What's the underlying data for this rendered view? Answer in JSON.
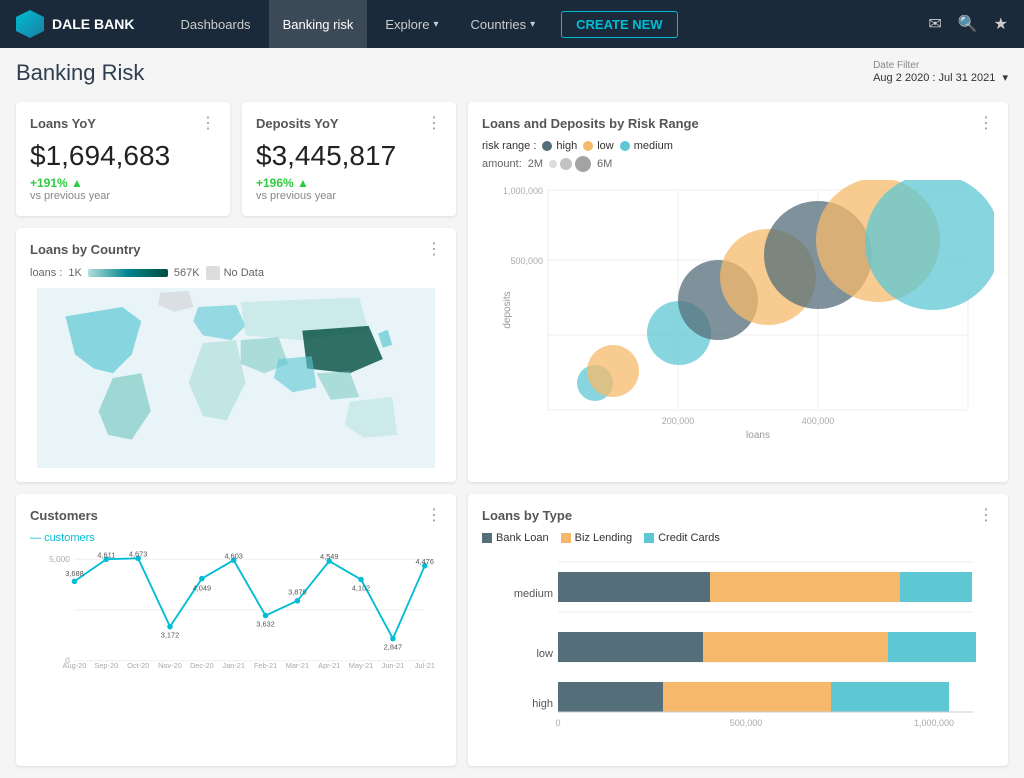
{
  "brand": {
    "name": "DALE BANK"
  },
  "nav": {
    "links": [
      {
        "id": "dashboards",
        "label": "Dashboards",
        "active": false,
        "hasChevron": false
      },
      {
        "id": "banking-risk",
        "label": "Banking risk",
        "active": true,
        "hasChevron": false
      },
      {
        "id": "explore",
        "label": "Explore",
        "active": false,
        "hasChevron": true
      },
      {
        "id": "countries",
        "label": "Countries",
        "active": false,
        "hasChevron": true
      }
    ],
    "create_label": "CREATE NEW"
  },
  "page": {
    "title": "Banking Risk",
    "date_filter_label": "Date Filter",
    "date_filter_value": "Aug 2 2020 : Jul 31 2021"
  },
  "kpi": {
    "loans": {
      "title": "Loans YoY",
      "value": "$1,694,683",
      "change": "+191%",
      "vs": "vs previous year"
    },
    "deposits": {
      "title": "Deposits YoY",
      "value": "$3,445,817",
      "change": "+196%",
      "vs": "vs previous year"
    }
  },
  "map": {
    "title": "Loans by Country",
    "legend_min": "1K",
    "legend_max": "567K",
    "legend_nodata": "No Data"
  },
  "customers": {
    "title": "Customers",
    "legend_label": "customers",
    "y_max": "5,000",
    "y_min": "0",
    "points": [
      {
        "label": "Aug-20",
        "value": 3688
      },
      {
        "label": "Sep-20",
        "value": 4611
      },
      {
        "label": "Oct-20",
        "value": 4673
      },
      {
        "label": "Nov-20",
        "value": 3172
      },
      {
        "label": "Dec-20",
        "value": 4049
      },
      {
        "label": "Jan-21",
        "value": 4603
      },
      {
        "label": "Feb-21",
        "value": 3632
      },
      {
        "label": "Mar-21",
        "value": 3879
      },
      {
        "label": "Apr-21",
        "value": 4549
      },
      {
        "label": "May-21",
        "value": 4102
      },
      {
        "label": "Jun-21",
        "value": 2847
      },
      {
        "label": "Jul-21",
        "value": 4476
      }
    ]
  },
  "scatter": {
    "title": "Loans and Deposits by Risk Range",
    "risk_label": "risk range :",
    "amount_label": "amount:",
    "amount_min": "2M",
    "amount_max": "6M",
    "legend": [
      {
        "label": "high",
        "color": "#546e7a"
      },
      {
        "label": "low",
        "color": "#f6b96b"
      },
      {
        "label": "medium",
        "color": "#5ec7d4"
      }
    ],
    "x_axis_label": "loans",
    "y_axis_label": "deposits",
    "x_ticks": [
      "200,000",
      "400,000"
    ],
    "y_ticks": [
      "500,000",
      "1,000,000"
    ],
    "bubbles": [
      {
        "x": 0.12,
        "y": 0.12,
        "r": 18,
        "color": "#5ec7d4"
      },
      {
        "x": 0.15,
        "y": 0.18,
        "r": 28,
        "color": "#f6b96b"
      },
      {
        "x": 0.35,
        "y": 0.42,
        "r": 34,
        "color": "#5ec7d4"
      },
      {
        "x": 0.42,
        "y": 0.52,
        "r": 42,
        "color": "#546e7a"
      },
      {
        "x": 0.52,
        "y": 0.62,
        "r": 50,
        "color": "#f6b96b"
      },
      {
        "x": 0.62,
        "y": 0.7,
        "r": 58,
        "color": "#546e7a"
      },
      {
        "x": 0.75,
        "y": 0.78,
        "r": 68,
        "color": "#f6b96b"
      },
      {
        "x": 0.88,
        "y": 0.8,
        "r": 74,
        "color": "#5ec7d4"
      }
    ]
  },
  "bar_chart": {
    "title": "Loans by Type",
    "legend": [
      {
        "label": "Bank Loan",
        "color": "#546e7a"
      },
      {
        "label": "Biz Lending",
        "color": "#f6b96b"
      },
      {
        "label": "Credit Cards",
        "color": "#5ec7d4"
      }
    ],
    "x_ticks": [
      "0",
      "500,000",
      "1,000,000"
    ],
    "categories": [
      {
        "label": "medium",
        "segments": [
          {
            "color": "#546e7a",
            "pct": 32
          },
          {
            "color": "#f6b96b",
            "pct": 44
          },
          {
            "color": "#5ec7d4",
            "pct": 18
          }
        ]
      },
      {
        "label": "low",
        "segments": [
          {
            "color": "#546e7a",
            "pct": 30
          },
          {
            "color": "#f6b96b",
            "pct": 40
          },
          {
            "color": "#5ec7d4",
            "pct": 22
          }
        ]
      },
      {
        "label": "high",
        "segments": [
          {
            "color": "#546e7a",
            "pct": 22
          },
          {
            "color": "#f6b96b",
            "pct": 36
          },
          {
            "color": "#5ec7d4",
            "pct": 26
          }
        ]
      }
    ]
  }
}
